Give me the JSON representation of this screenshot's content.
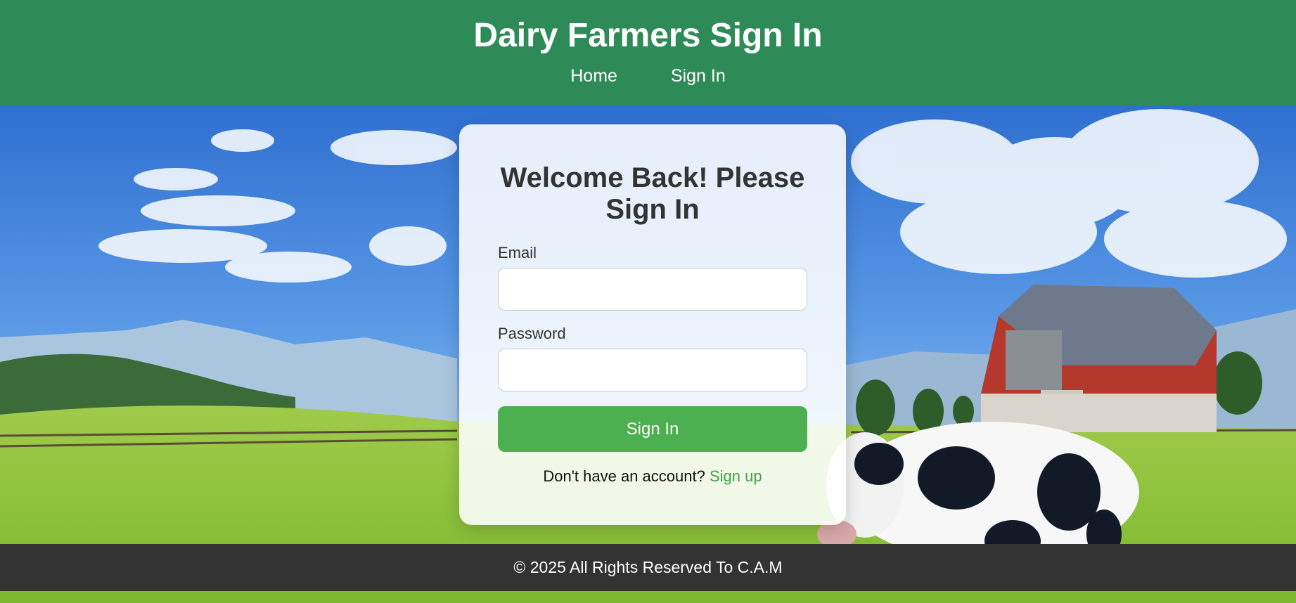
{
  "header": {
    "title": "Dairy Farmers Sign In",
    "nav": [
      {
        "label": "Home"
      },
      {
        "label": "Sign In"
      }
    ]
  },
  "form": {
    "heading": "Welcome Back! Please Sign In",
    "email_label": "Email",
    "email_value": "",
    "password_label": "Password",
    "password_value": "",
    "submit_label": "Sign In",
    "signup_prompt": "Don't have an account?",
    "signup_link": "Sign up"
  },
  "footer": {
    "text": "© 2025 All Rights Reserved To C.A.M"
  },
  "colors": {
    "header_bg": "#2e8b57",
    "button": "#4caf50",
    "link": "#3ea346",
    "footer_bg": "#333333"
  }
}
